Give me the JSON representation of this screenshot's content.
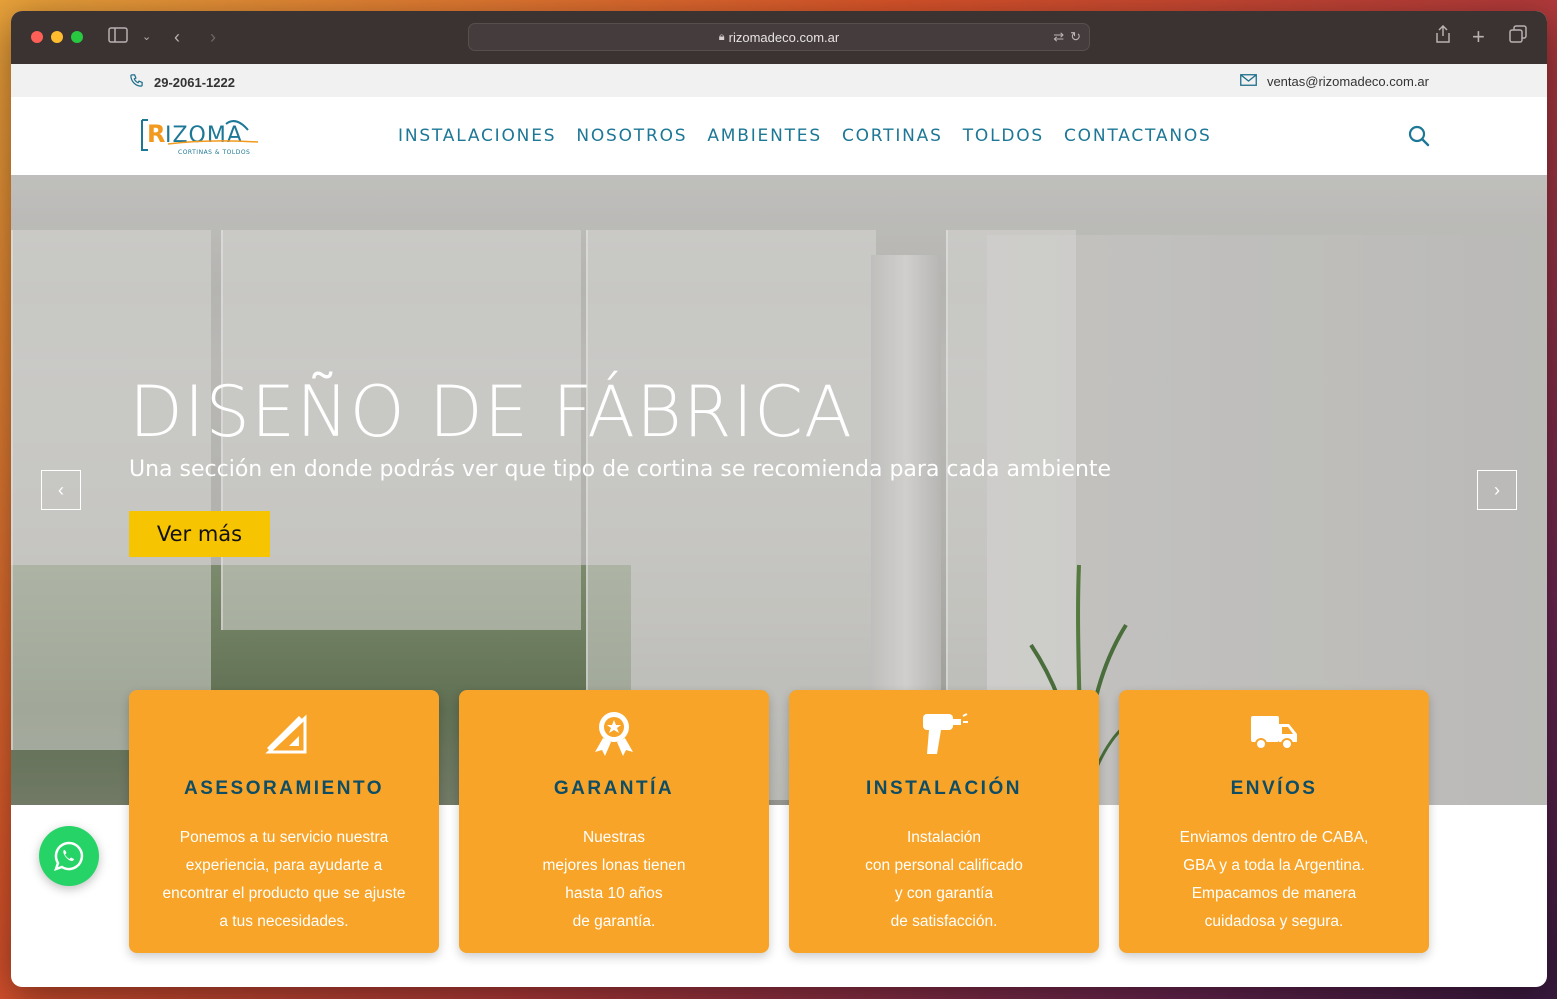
{
  "browser": {
    "url": "rizomadeco.com.ar"
  },
  "topbar": {
    "phone": "29-2061-1222",
    "email": "ventas@rizomadeco.com.ar"
  },
  "nav": {
    "logo_text": "RIZOMA",
    "logo_tagline": "CORTINAS & TOLDOS",
    "items": [
      "INSTALACIONES",
      "NOSOTROS",
      "AMBIENTES",
      "CORTINAS",
      "TOLDOS",
      "CONTACTANOS"
    ]
  },
  "hero": {
    "title": "DISEÑO DE FÁBRICA",
    "subtitle": "Una sección en donde podrás ver que tipo de cortina se recomienda para cada ambiente",
    "button": "Ver más"
  },
  "cards": [
    {
      "icon": "ruler-pencil-icon",
      "title": "ASESORAMIENTO",
      "lines": [
        "Ponemos a tu servicio nuestra",
        "experiencia, para ayudarte a",
        "encontrar el producto que se ajuste",
        "a tus necesidades."
      ]
    },
    {
      "icon": "award-ribbon-icon",
      "title": "GARANTÍA",
      "lines": [
        "Nuestras",
        "mejores lonas tienen",
        "hasta 10 años",
        "de garantía."
      ]
    },
    {
      "icon": "drill-icon",
      "title": "INSTALACIÓN",
      "lines": [
        "Instalación",
        "con personal calificado",
        "y con garantía",
        "de satisfacción."
      ]
    },
    {
      "icon": "truck-icon",
      "title": "ENVÍOS",
      "lines": [
        "Enviamos dentro de CABA,",
        "GBA y a toda la Argentina.",
        "Empacamos de manera",
        "cuidadosa y segura."
      ]
    }
  ],
  "colors": {
    "brand_blue": "#1d7796",
    "card_orange": "#f7a428",
    "button_yellow": "#f6c400",
    "whatsapp_green": "#26d366"
  }
}
